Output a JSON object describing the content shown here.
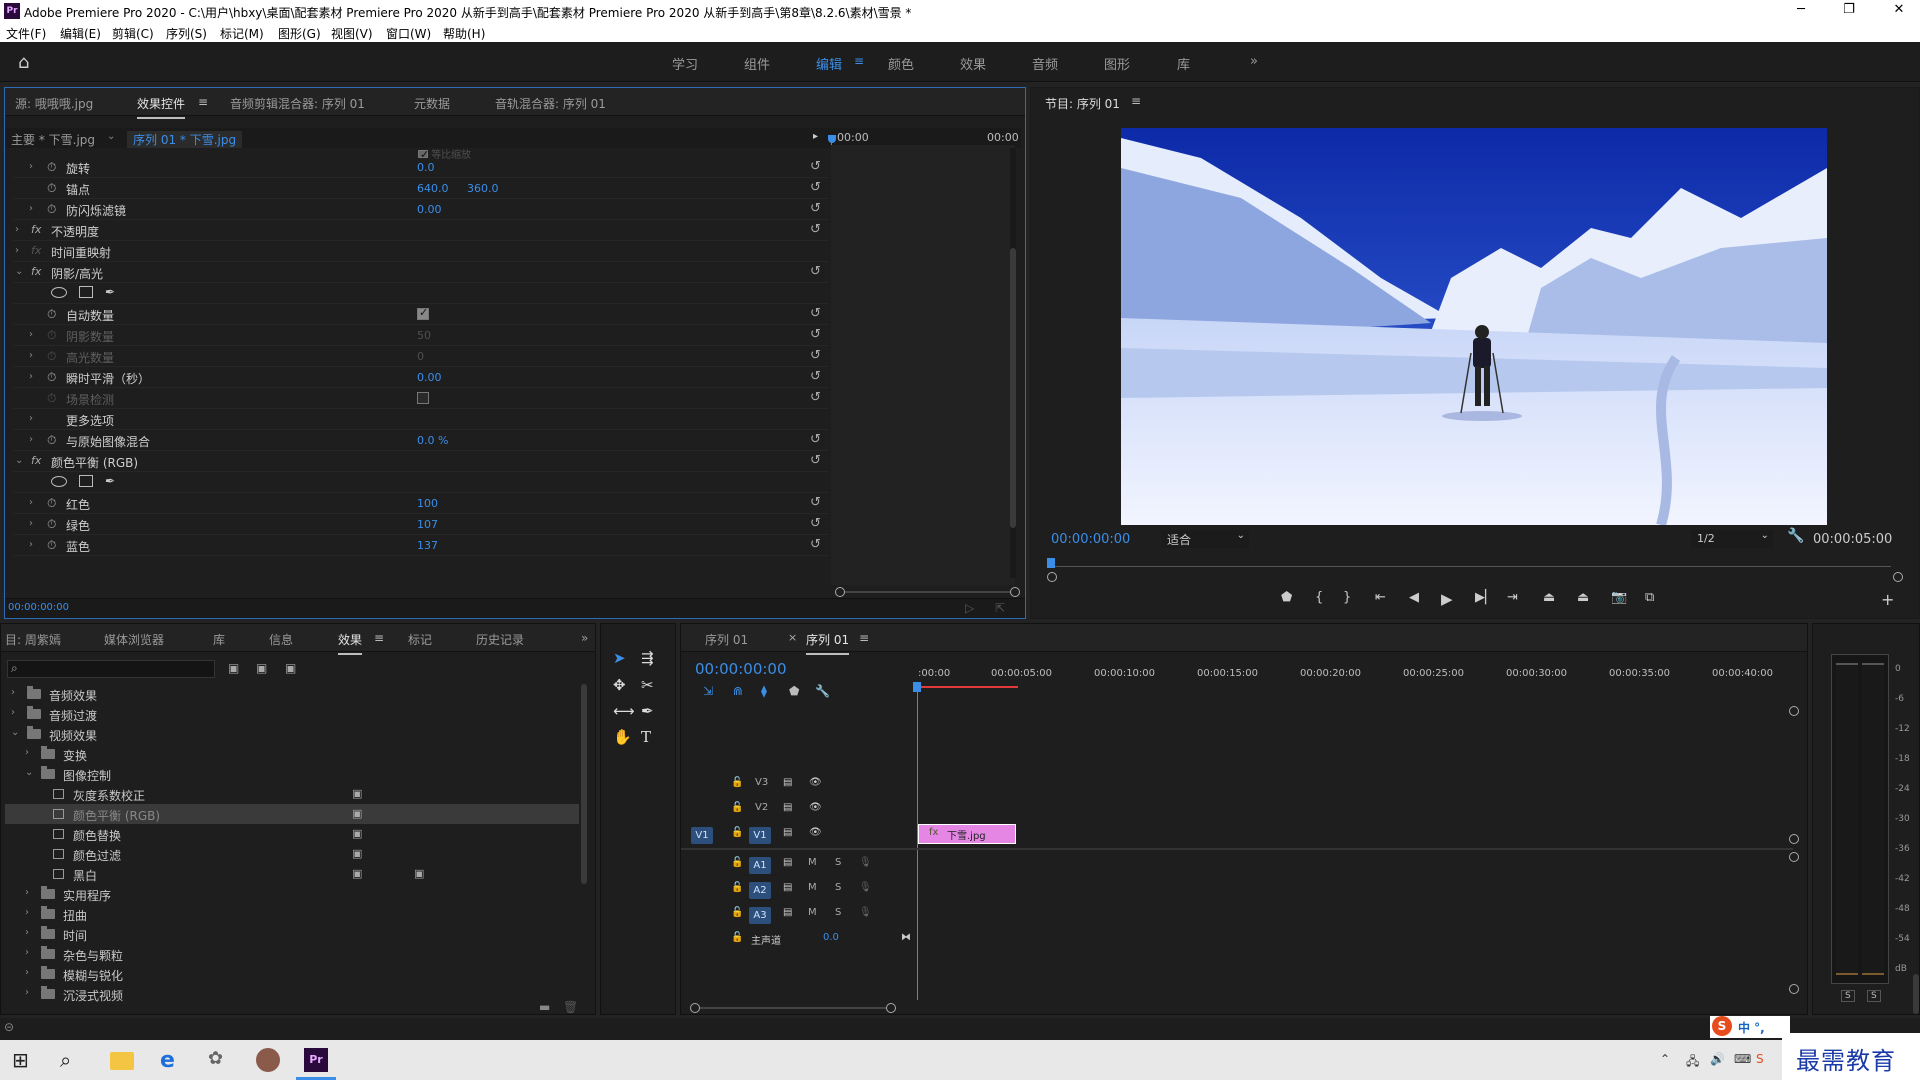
{
  "window": {
    "title": "Adobe Premiere Pro 2020 - C:\\用户\\hbxy\\桌面\\配套素材 Premiere Pro 2020 从新手到高手\\配套素材 Premiere Pro 2020 从新手到高手\\第8章\\8.2.6\\素材\\雪景 *",
    "logo": "Pr"
  },
  "menu": [
    "文件(F)",
    "编辑(E)",
    "剪辑(C)",
    "序列(S)",
    "标记(M)",
    "图形(G)",
    "视图(V)",
    "窗口(W)",
    "帮助(H)"
  ],
  "workspaces": [
    "学习",
    "组件",
    "编辑",
    "颜色",
    "效果",
    "音频",
    "图形",
    "库"
  ],
  "effect_controls": {
    "tabs": [
      "源: 哦哦哦.jpg",
      "效果控件",
      "音频剪辑混合器: 序列 01",
      "元数据",
      "音轨混合器: 序列 01"
    ],
    "master": "主要 * 下雪.jpg",
    "clip": "序列 01 * 下雪.jpg",
    "time_start": "00:00",
    "time_end": "00:00",
    "partial_label": "等比缩放",
    "rows": [
      {
        "label": "旋转",
        "v1": "0.0"
      },
      {
        "label": "锚点",
        "v1": "640.0",
        "v2": "360.0"
      },
      {
        "label": "防闪烁滤镜",
        "v1": "0.00"
      },
      {
        "label": "不透明度"
      },
      {
        "label": "时间重映射"
      },
      {
        "label": "阴影/高光"
      },
      {
        "label": ""
      },
      {
        "label": "自动数量",
        "check": true
      },
      {
        "label": "阴影数量",
        "v1": "50"
      },
      {
        "label": "高光数量",
        "v1": "0"
      },
      {
        "label": "瞬时平滑（秒）",
        "v1": "0.00"
      },
      {
        "label": "场景检测",
        "check": false
      },
      {
        "label": "更多选项"
      },
      {
        "label": "与原始图像混合",
        "v1": "0.0 %"
      },
      {
        "label": "颜色平衡 (RGB)"
      },
      {
        "label": ""
      },
      {
        "label": "红色",
        "v1": "100"
      },
      {
        "label": "绿色",
        "v1": "107"
      },
      {
        "label": "蓝色",
        "v1": "137"
      }
    ],
    "timecode": "00:00:00:00"
  },
  "program": {
    "title": "节目: 序列 01",
    "timecode": "00:00:00:00",
    "fit": "适合",
    "resolution": "1/2",
    "duration": "00:00:05:00"
  },
  "effects_panel": {
    "tabs": [
      "目: 周紫嫣",
      "媒体浏览器",
      "库",
      "信息",
      "效果",
      "标记",
      "历史记录"
    ],
    "search": "",
    "items": [
      {
        "label": "音频效果"
      },
      {
        "label": "音频过渡"
      },
      {
        "label": "视频效果"
      },
      {
        "label": "变换"
      },
      {
        "label": "图像控制"
      },
      {
        "label": "灰度系数校正"
      },
      {
        "label": "颜色平衡 (RGB)"
      },
      {
        "label": "颜色替换"
      },
      {
        "label": "颜色过滤"
      },
      {
        "label": "黑白"
      },
      {
        "label": "实用程序"
      },
      {
        "label": "扭曲"
      },
      {
        "label": "时间"
      },
      {
        "label": "杂色与颗粒"
      },
      {
        "label": "模糊与锐化"
      },
      {
        "label": "沉浸式视频"
      }
    ]
  },
  "timeline": {
    "tabs": [
      "序列 01",
      "序列 01"
    ],
    "timecode": "00:00:00:00",
    "ruler": [
      ":00:00",
      "00:00:05:00",
      "00:00:10:00",
      "00:00:15:00",
      "00:00:20:00",
      "00:00:25:00",
      "00:00:30:00",
      "00:00:35:00",
      "00:00:40:00"
    ],
    "video_tracks": [
      "V3",
      "V2",
      "V1"
    ],
    "audio_tracks": [
      "A1",
      "A2",
      "A3"
    ],
    "source_v": "V1",
    "mute": "M",
    "solo": "S",
    "master": "主声道",
    "master_val": "0.0",
    "clip": "下雪.jpg",
    "clip_fx": "fx"
  },
  "meter": {
    "labels": [
      "0",
      "-6",
      "-12",
      "-18",
      "-24",
      "-30",
      "-36",
      "-42",
      "-48",
      "-54",
      "dB"
    ],
    "solo": [
      "S",
      "S"
    ]
  },
  "ime": {
    "logo": "S",
    "text": "中 °,"
  },
  "watermark": "最需教育"
}
